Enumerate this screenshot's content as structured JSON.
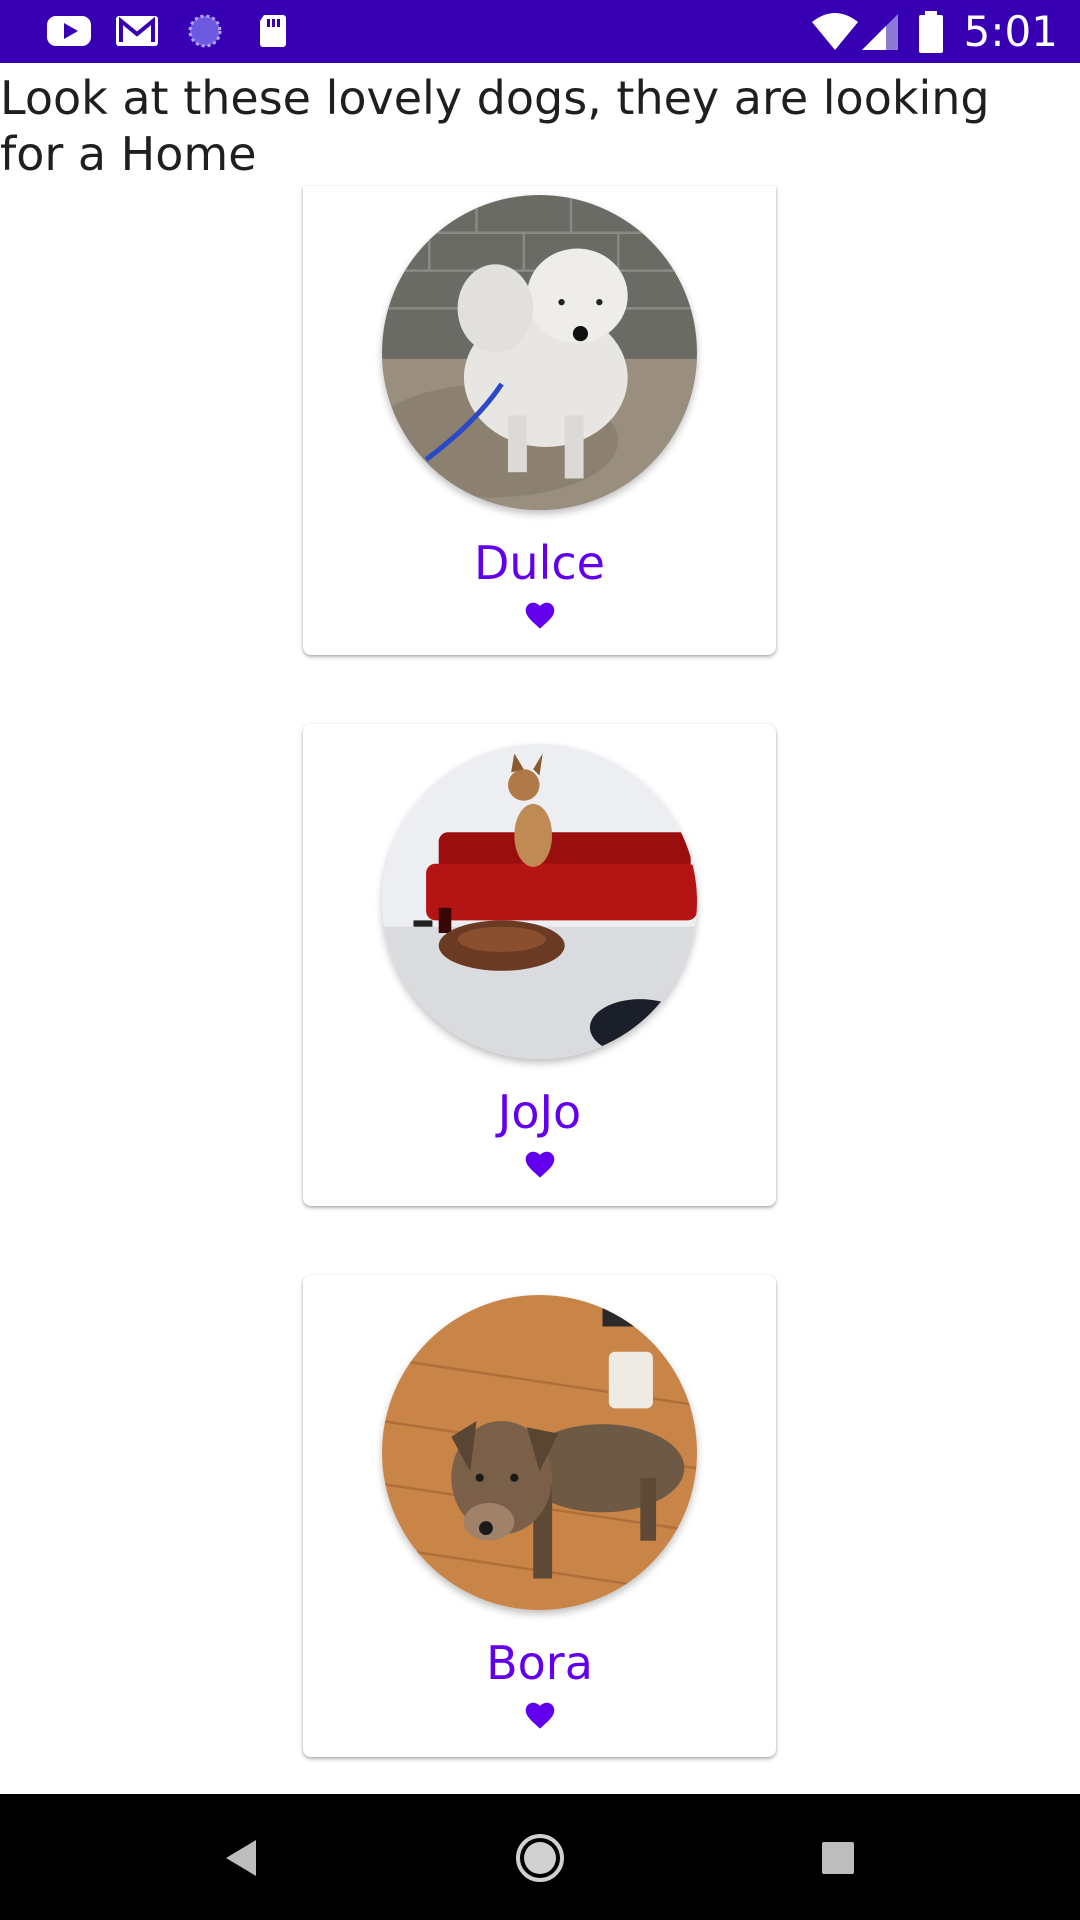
{
  "status_bar": {
    "time": "5:01",
    "icons": [
      "youtube-icon",
      "gmail-icon",
      "sync-icon",
      "sd-card-icon",
      "wifi-icon",
      "signal-icon",
      "battery-icon"
    ]
  },
  "page": {
    "title": "Look at these lovely dogs, they are looking for a Home"
  },
  "dogs": [
    {
      "name": "Dulce",
      "favorite_icon": "heart-icon"
    },
    {
      "name": "JoJo",
      "favorite_icon": "heart-icon"
    },
    {
      "name": "Bora",
      "favorite_icon": "heart-icon"
    }
  ],
  "colors": {
    "status_bar": "#3700b3",
    "accent": "#6200ee",
    "nav_bar": "#000000"
  },
  "nav_bar": {
    "buttons": [
      "back-icon",
      "home-icon",
      "recents-icon"
    ]
  }
}
